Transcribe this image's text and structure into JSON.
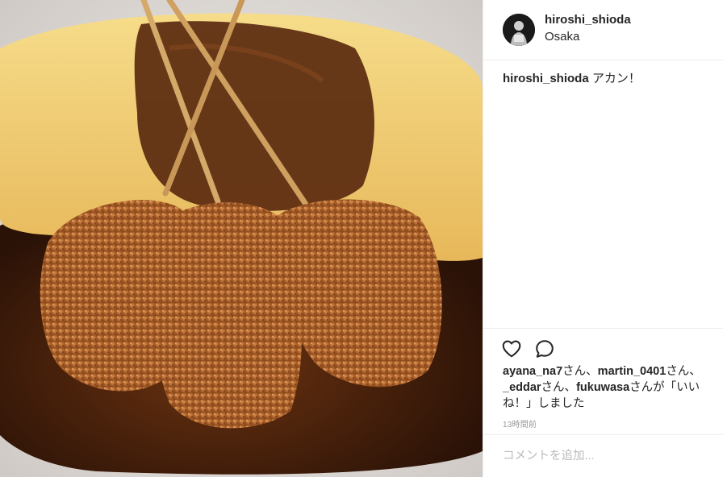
{
  "post": {
    "author": "hiroshi_shioda",
    "location": "Osaka",
    "caption_user": "hiroshi_shioda",
    "caption_text": " アカン！",
    "likes": {
      "user1": "ayana_na7",
      "sep1": "さん、",
      "user2": "martin_0401",
      "sep2": "さん、",
      "user3": "_eddar",
      "sep3": "さん、",
      "user4": "fukuwasa",
      "tail": "さんが「いいね！」しました"
    },
    "timestamp": "13時間前",
    "comment_placeholder": "コメントを追加..."
  },
  "icons": {
    "like": "heart-icon",
    "comment": "comment-icon"
  },
  "colors": {
    "text": "#262626",
    "muted": "#999999",
    "divider": "#efefef"
  }
}
